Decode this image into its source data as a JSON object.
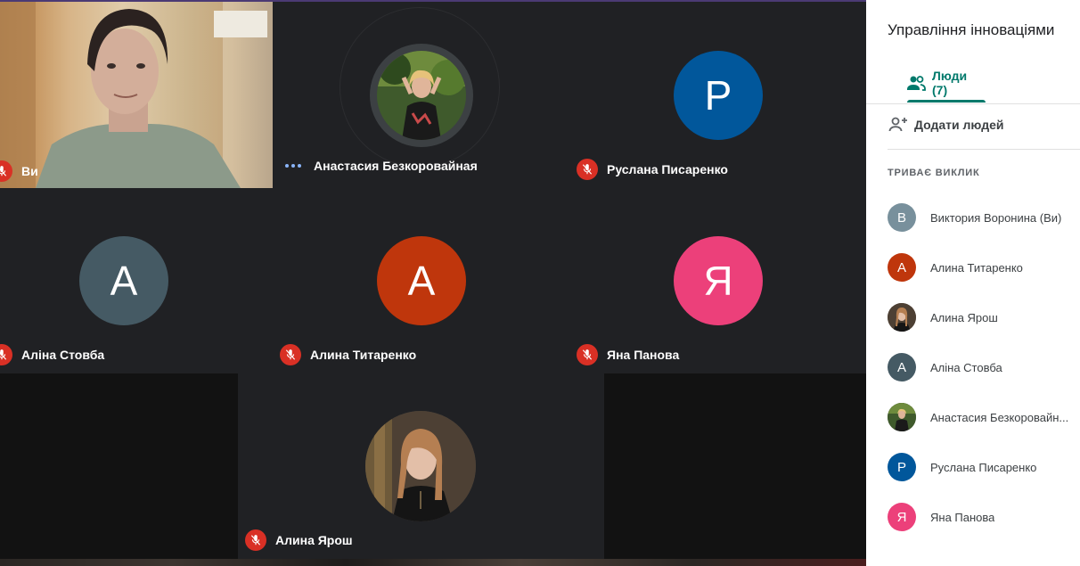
{
  "panel": {
    "title": "Управління інноваціями",
    "tab_people": "Люди (7)",
    "add_people": "Додати людей",
    "section_in_call": "ТРИВАЄ ВИКЛИК",
    "participants": [
      {
        "initial": "В",
        "name": "Виктория Воронина (Ви)",
        "color": "#78909c"
      },
      {
        "initial": "А",
        "name": "Алина Титаренко",
        "color": "#bf360c"
      },
      {
        "initial": "",
        "name": "Алина Ярош",
        "color": "#6d5a4e"
      },
      {
        "initial": "А",
        "name": "Аліна Стовба",
        "color": "#455a64"
      },
      {
        "initial": "",
        "name": "Анастасия Безкоровайн...",
        "color": "#3b4a35"
      },
      {
        "initial": "Р",
        "name": "Руслана Писаренко",
        "color": "#01579b"
      },
      {
        "initial": "Я",
        "name": "Яна Панова",
        "color": "#ec407a"
      }
    ]
  },
  "tiles": {
    "self_label": "Ви",
    "anastasia": {
      "name": "Анастасия Безкоровайная"
    },
    "ruslana": {
      "initial": "Р",
      "name": "Руслана Писаренко",
      "color": "#01579b"
    },
    "alina_stovba": {
      "initial": "А",
      "name": "Аліна Стовба",
      "color": "#455a64"
    },
    "alina_titarenko": {
      "initial": "А",
      "name": "Алина Титаренко",
      "color": "#bf360c"
    },
    "yana": {
      "initial": "Я",
      "name": "Яна Панова",
      "color": "#ec407a"
    },
    "alina_yarosh": {
      "name": "Алина Ярош"
    }
  },
  "icons": {
    "mic_off": "mic-off-icon",
    "people": "people-icon",
    "add_person": "person-add-icon",
    "speaking": "speaking-dots-icon"
  }
}
